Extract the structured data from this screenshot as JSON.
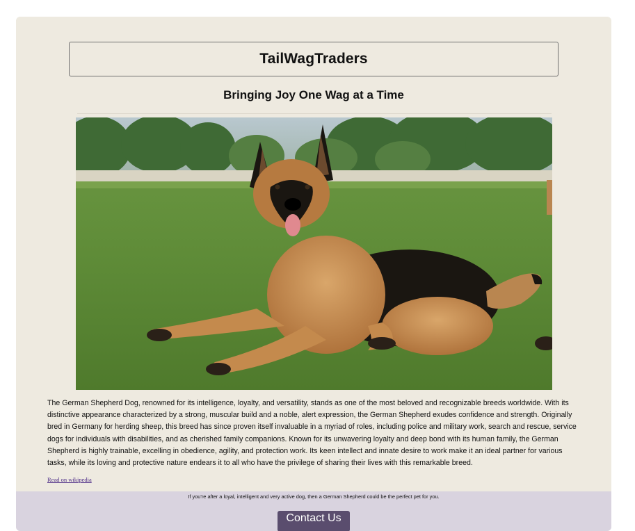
{
  "header": {
    "title": "TailWagTraders"
  },
  "hero": {
    "tagline": "Bringing Joy One Wag at a Time"
  },
  "image": {
    "subject": "German Shepherd dog lying on grass"
  },
  "content": {
    "description": "The German Shepherd Dog, renowned for its intelligence, loyalty, and versatility, stands as one of the most beloved and recognizable breeds worldwide. With its distinctive appearance characterized by a strong, muscular build and a noble, alert expression, the German Shepherd exudes confidence and strength. Originally bred in Germany for herding sheep, this breed has since proven itself invaluable in a myriad of roles, including police and military work, search and rescue, service dogs for individuals with disabilities, and as cherished family companions. Known for its unwavering loyalty and deep bond with its human family, the German Shepherd is highly trainable, excelling in obedience, agility, and protection work. Its keen intellect and innate desire to work make it an ideal partner for various tasks, while its loving and protective nature endears it to all who have the privilege of sharing their lives with this remarkable breed.",
    "link_label": "Read on wikipedia"
  },
  "footer": {
    "text": "If you're after a loyal, intelligent and very active dog, then a German Shepherd could be the perfect pet for you.",
    "contact_label": "Contact Us"
  },
  "colors": {
    "card_bg": "#eeeae0",
    "footer_bg": "#d9d3df",
    "button_bg": "#5a4d6e",
    "link": "#4b2a86"
  }
}
